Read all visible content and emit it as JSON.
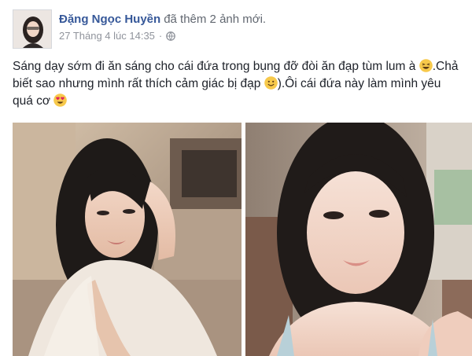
{
  "post": {
    "author": "Đặng Ngọc Huyền",
    "action": "đã thêm 2 ảnh mới.",
    "timestamp": "27 Tháng 4 lúc 14:35",
    "separator": "·",
    "privacy_icon": "globe-icon",
    "text_part1": "Sáng dạy sớm đi ăn sáng cho cái đứa trong bụng đỡ đòi ăn đạp tùm lum à",
    "text_part2": ".Chả biết sao nhưng mình rất thích cảm giác bị đạp",
    "text_part3": ").Ôi cái đứa này làm mình yêu quá cơ",
    "emojis": [
      "laughing-emoji-icon",
      "smiling-emoji-icon",
      "heart-eyes-emoji-icon"
    ],
    "photos": [
      "photo-in-car-seat",
      "photo-selfie-close-up"
    ]
  },
  "colors": {
    "author_link": "#365899",
    "meta": "#90949c",
    "body_text": "#1d2129",
    "emoji_yellow": "#f7c94b"
  }
}
